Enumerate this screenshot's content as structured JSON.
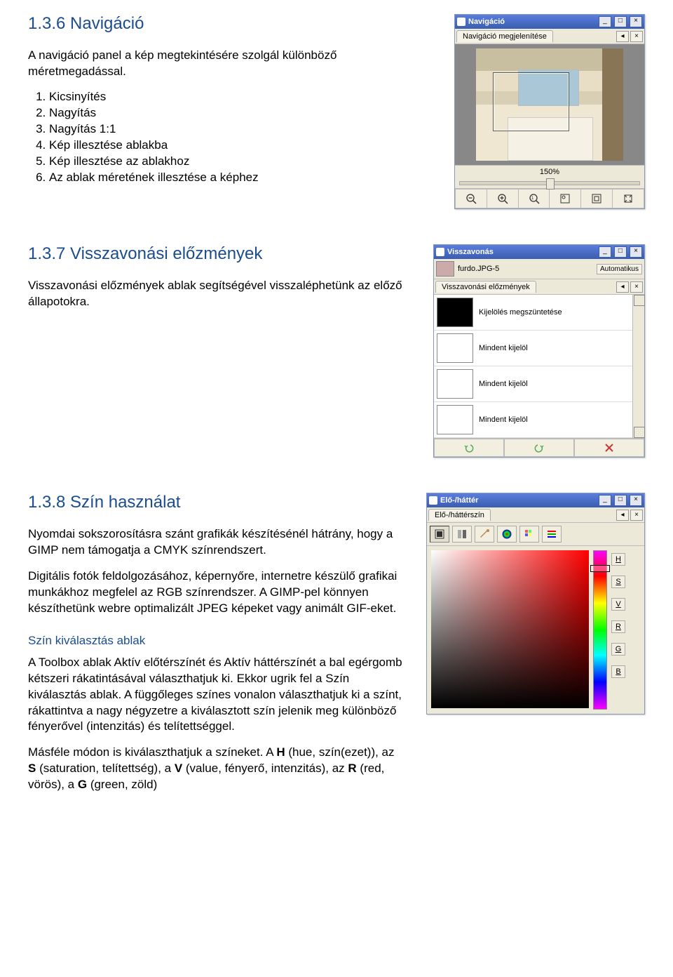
{
  "sec136": {
    "title": "1.3.6 Navigáció",
    "intro": "A navigáció panel a kép megtekintésére szolgál különböző méretmegadással.",
    "items": [
      "Kicsinyítés",
      "Nagyítás",
      "Nagyítás 1:1",
      "Kép illesztése ablakba",
      "Kép illesztése az ablakhoz",
      "Az ablak méretének illesztése a képhez"
    ]
  },
  "nav_panel": {
    "title": "Navigáció",
    "tab": "Navigáció megjelenítése",
    "zoom": "150%"
  },
  "sec137": {
    "title": "1.3.7 Visszavonási előzmények",
    "intro": "Visszavonási előzmények ablak segítségével visszaléphetünk az előző állapotokra."
  },
  "undo_panel": {
    "title": "Visszavonás",
    "file": "furdo.JPG-5",
    "auto": "Automatikus",
    "tab": "Visszavonási előzmények",
    "items": [
      "Kijelölés megszüntetése",
      "Mindent kijelöl",
      "Mindent kijelöl",
      "Mindent kijelöl"
    ]
  },
  "sec138": {
    "title": "1.3.8 Szín használat",
    "p1": "Nyomdai sokszorosításra szánt grafikák készítésénél hátrány, hogy a GIMP nem támogatja a CMYK színrendszert.",
    "p2": "Digitális fotók feldolgozásához, képernyőre, internetre készülő grafikai munkákhoz megfelel az RGB színrendszer. A GIMP-pel könnyen készíthetünk webre optimalizált JPEG képeket vagy animált GIF-eket.",
    "sub": "Szín kiválasztás ablak",
    "p3": "A Toolbox ablak Aktív előtérszínét és Aktív háttérszínét a bal egérgomb kétszeri rákatintásával választhatjuk ki. Ekkor ugrik fel a Szín kiválasztás ablak. A függőleges színes vonalon választhatjuk ki a színt, rákattintva a nagy négyzetre a kiválasztott szín jelenik meg különböző fényerővel (intenzitás) és telítettséggel.",
    "p4_prefix": "Másféle módon is kiválaszthatjuk a színeket. A ",
    "p4_h": "H",
    "p4_h2": " (hue, szín(ezet)), az ",
    "p4_s": "S",
    "p4_s2": " (saturation, telítettség), a ",
    "p4_v": "V",
    "p4_v2": " (value, fényerő, intenzitás), az ",
    "p4_r": "R",
    "p4_r2": " (red, vörös), a ",
    "p4_g": "G",
    "p4_g2": " (green, zöld)"
  },
  "color_panel": {
    "title": "Elő-/háttér",
    "tab": "Elő-/háttérszín",
    "channels": [
      "H",
      "S",
      "V",
      "R",
      "G",
      "B"
    ]
  },
  "glyph": {
    "min": "_",
    "max": "□",
    "close": "×",
    "left": "◂",
    "right": "▸",
    "x": "×"
  }
}
